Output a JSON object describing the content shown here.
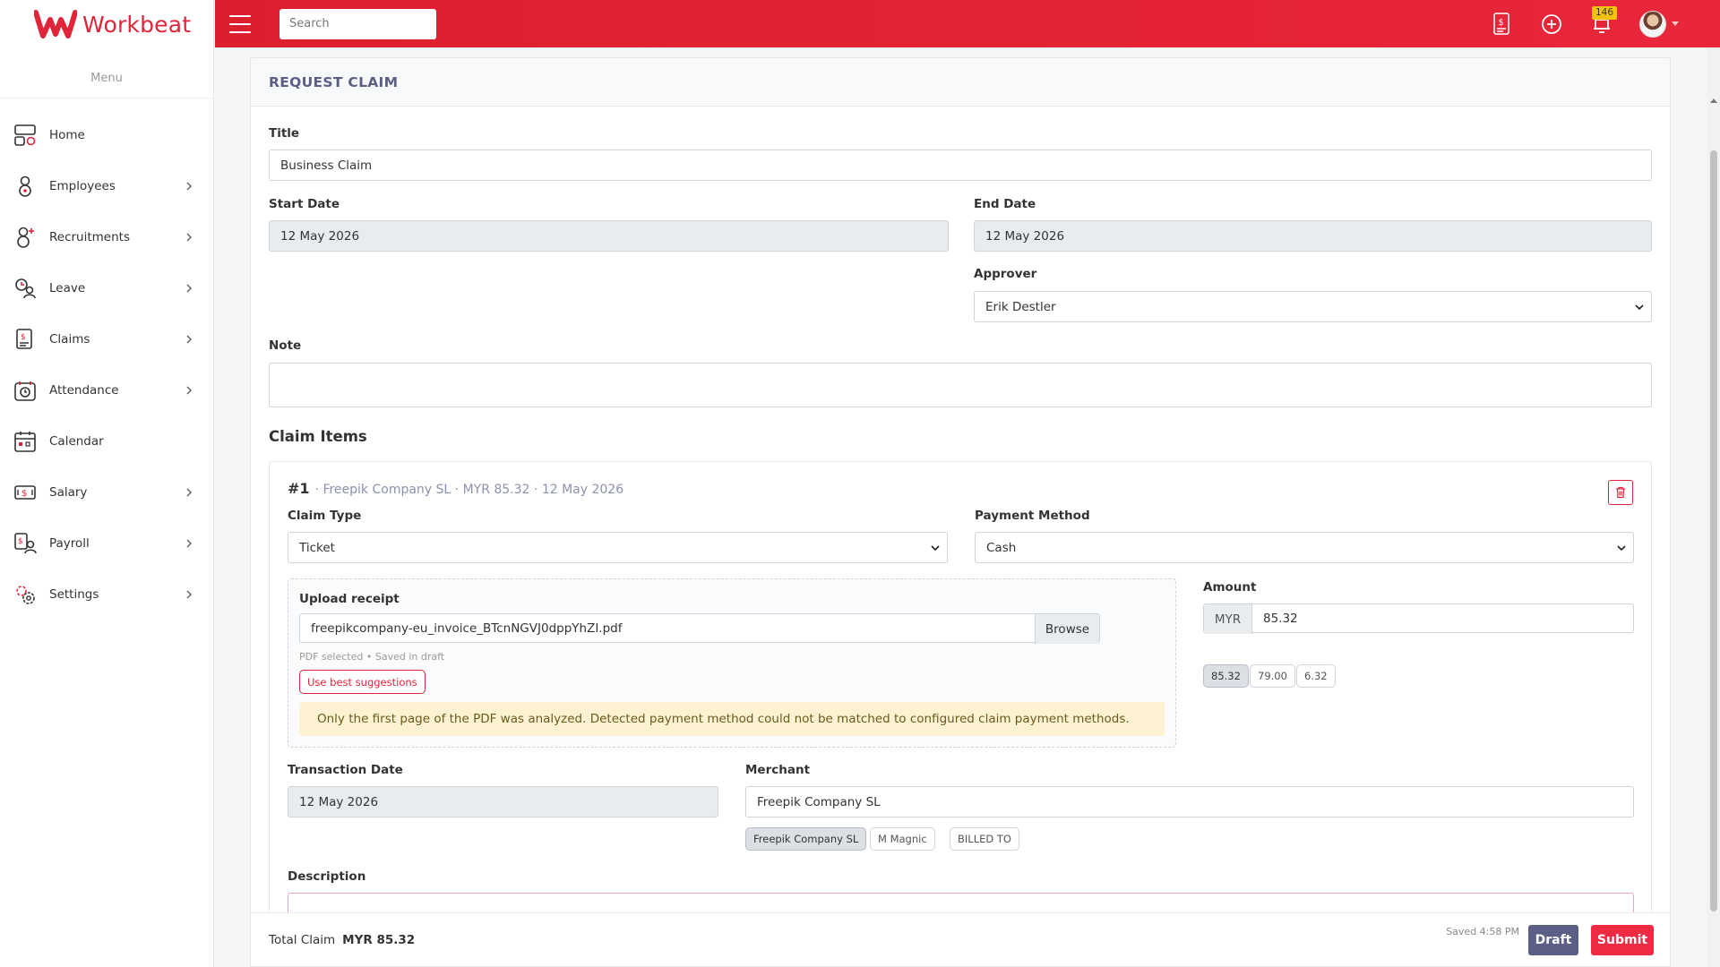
{
  "app": {
    "brand": "Workbeat"
  },
  "sidebar": {
    "menu_label": "Menu",
    "items": [
      {
        "label": "Home",
        "icon": "home-icon",
        "has_children": false
      },
      {
        "label": "Employees",
        "icon": "employees-icon",
        "has_children": true
      },
      {
        "label": "Recruitments",
        "icon": "recruitments-icon",
        "has_children": true
      },
      {
        "label": "Leave",
        "icon": "leave-icon",
        "has_children": true
      },
      {
        "label": "Claims",
        "icon": "claims-icon",
        "has_children": true
      },
      {
        "label": "Attendance",
        "icon": "attendance-icon",
        "has_children": true
      },
      {
        "label": "Calendar",
        "icon": "calendar-icon",
        "has_children": false
      },
      {
        "label": "Salary",
        "icon": "salary-icon",
        "has_children": true
      },
      {
        "label": "Payroll",
        "icon": "payroll-icon",
        "has_children": true
      },
      {
        "label": "Settings",
        "icon": "settings-icon",
        "has_children": true
      }
    ]
  },
  "topbar": {
    "search_placeholder": "Search",
    "notification_count": "146",
    "icons": [
      "claim-request-icon",
      "add-circle-icon",
      "notification-icon",
      "user-avatar"
    ]
  },
  "form": {
    "header": "REQUEST CLAIM",
    "title_label": "Title",
    "title_value": "Business Claim",
    "start_date_label": "Start Date",
    "start_date_value": "12 May 2026",
    "end_date_label": "End Date",
    "end_date_value": "12 May 2026",
    "approver_label": "Approver",
    "approver_value": "Erik Destler",
    "note_label": "Note",
    "note_value": ""
  },
  "claim_items": {
    "section_title": "Claim Items",
    "items": [
      {
        "number": "#1",
        "summary": "· Freepik Company SL · MYR 85.32 · 12 May 2026",
        "claim_type_label": "Claim Type",
        "claim_type_value": "Ticket",
        "payment_method_label": "Payment Method",
        "payment_method_value": "Cash",
        "upload_label": "Upload receipt",
        "file_name": "freepikcompany-eu_invoice_BTcnNGVJ0dppYhZI.pdf",
        "browse_label": "Browse",
        "upload_hint": "PDF selected • Saved in draft",
        "suggest_label": "Use best suggestions",
        "alert_text": "Only the first page of the PDF was analyzed. Detected payment method could not be matched to configured claim payment methods.",
        "amount_label": "Amount",
        "currency": "MYR",
        "amount_value": "85.32",
        "amount_suggestions": [
          "85.32",
          "79.00",
          "6.32"
        ],
        "transaction_date_label": "Transaction Date",
        "transaction_date_value": "12 May 2026",
        "merchant_label": "Merchant",
        "merchant_value": "Freepik Company SL",
        "merchant_suggestions": [
          "Freepik Company SL",
          "M Magnic",
          "BILLED TO"
        ],
        "description_label": "Description",
        "description_value": ""
      }
    ]
  },
  "footer": {
    "total_label": "Total Claim",
    "total_value": "MYR 85.32",
    "saved_text": "Saved 4:58 PM",
    "draft_label": "Draft",
    "submit_label": "Submit"
  },
  "colors": {
    "brand_red": "#e0243a",
    "header_text": "#5b5f86",
    "draft_button": "#5b5f86",
    "submit_button": "#ee2b43",
    "badge": "#f4c20d"
  }
}
